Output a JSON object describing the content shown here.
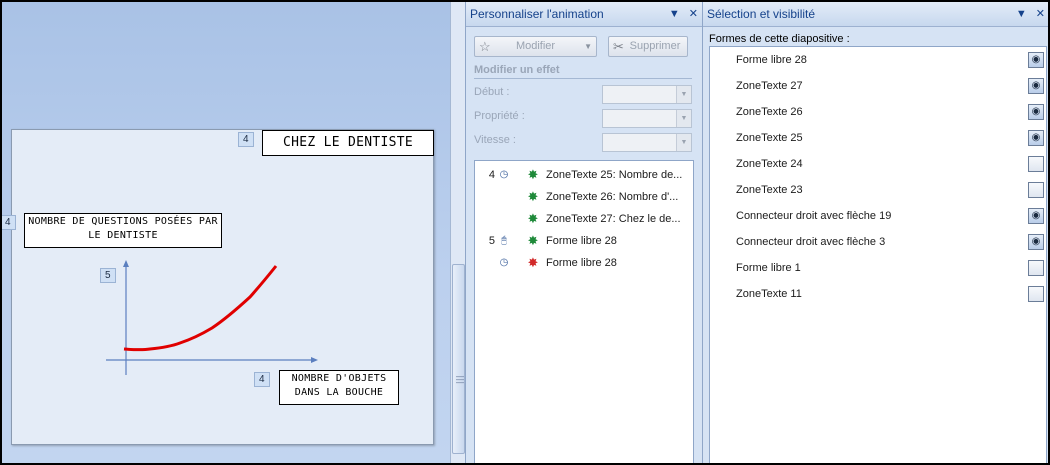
{
  "slide": {
    "title_tag": "4",
    "title": "Chez le dentiste",
    "ylabel_tag": "4",
    "ylabel": "Nombre de questions posées par le dentiste",
    "curve_tag": "5",
    "xlabel_tag": "4",
    "xlabel": "Nombre d'objets dans la bouche",
    "curve_color": "#e00000",
    "axis_color": "#5b7fbf"
  },
  "animation_pane": {
    "title": "Personnaliser l'animation",
    "modify_button": "Modifier",
    "delete_button": "Supprimer",
    "section": "Modifier un effet",
    "fields": [
      {
        "label": "Début :",
        "value": ""
      },
      {
        "label": "Propriété :",
        "value": ""
      },
      {
        "label": "Vitesse :",
        "value": ""
      }
    ],
    "items": [
      {
        "num": "4",
        "trigger": "clock-icon",
        "effect": "entrance-star-icon",
        "label": "ZoneTexte 25: Nombre de..."
      },
      {
        "num": "",
        "trigger": "",
        "effect": "entrance-star-icon",
        "label": "ZoneTexte 26: Nombre d'..."
      },
      {
        "num": "",
        "trigger": "",
        "effect": "entrance-star-icon",
        "label": "ZoneTexte 27: Chez le de..."
      },
      {
        "num": "5",
        "trigger": "mouse-icon",
        "effect": "entrance-star-icon",
        "label": "Forme libre 28"
      },
      {
        "num": "",
        "trigger": "clock-icon",
        "effect": "exit-star-icon",
        "label": "Forme libre 28"
      }
    ]
  },
  "selection_pane": {
    "title": "Sélection et visibilité",
    "list_label": "Formes de cette diapositive :",
    "shapes": [
      {
        "name": "Forme libre 28",
        "visible": true
      },
      {
        "name": "ZoneTexte 27",
        "visible": true
      },
      {
        "name": "ZoneTexte 26",
        "visible": true
      },
      {
        "name": "ZoneTexte 25",
        "visible": true
      },
      {
        "name": "ZoneTexte 24",
        "visible": false
      },
      {
        "name": "ZoneTexte 23",
        "visible": false
      },
      {
        "name": "Connecteur droit avec flèche 19",
        "visible": true
      },
      {
        "name": "Connecteur droit avec flèche 3",
        "visible": true
      },
      {
        "name": "Forme libre 1",
        "visible": false
      },
      {
        "name": "ZoneTexte 11",
        "visible": false
      }
    ]
  }
}
